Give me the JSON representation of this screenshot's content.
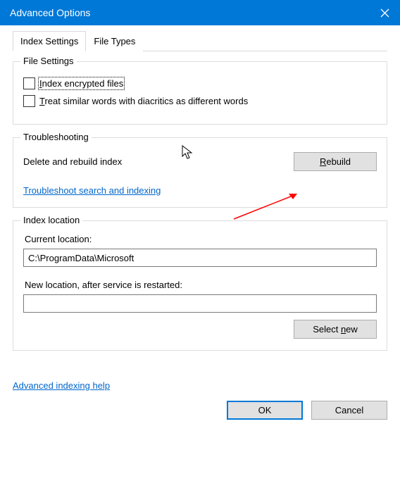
{
  "titlebar": {
    "title": "Advanced Options"
  },
  "tabs": {
    "index_settings": "Index Settings",
    "file_types": "File Types"
  },
  "file_settings": {
    "legend": "File Settings",
    "index_encrypted": "Index encrypted files",
    "diacritics": "Treat similar words with diacritics as different words"
  },
  "troubleshooting": {
    "legend": "Troubleshooting",
    "delete_rebuild": "Delete and rebuild index",
    "rebuild_btn": "Rebuild",
    "link": "Troubleshoot search and indexing"
  },
  "index_location": {
    "legend": "Index location",
    "current_label": "Current location:",
    "current_value": "C:\\ProgramData\\Microsoft",
    "new_label": "New location, after service is restarted:",
    "new_value": "",
    "select_new": "Select new"
  },
  "footer": {
    "help_link": "Advanced indexing help",
    "ok": "OK",
    "cancel": "Cancel"
  }
}
